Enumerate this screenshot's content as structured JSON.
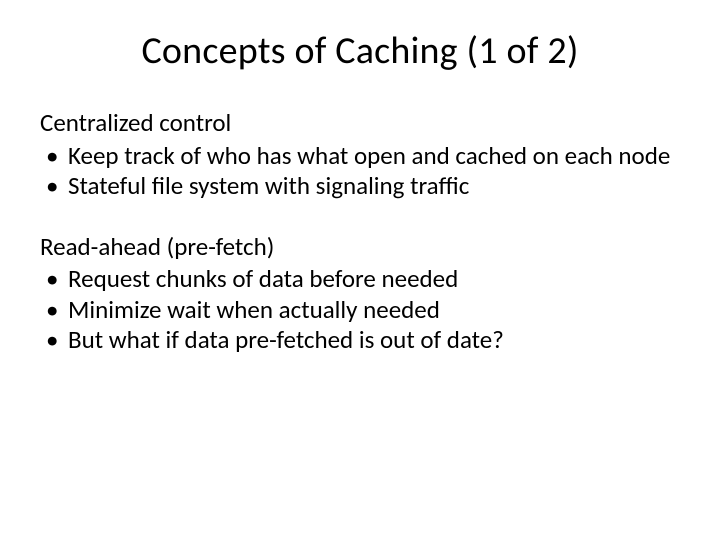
{
  "title": "Concepts of Caching (1 of 2)",
  "section1": {
    "label": "Centralized control",
    "bullets": [
      "Keep track of who has what open and cached on each node",
      "Stateful file system with signaling traffic"
    ]
  },
  "section2": {
    "label": "Read-ahead (pre-fetch)",
    "bullets": [
      "Request chunks of data before needed",
      "Minimize wait when actually needed",
      "But what if data pre-fetched is out of date?"
    ]
  }
}
